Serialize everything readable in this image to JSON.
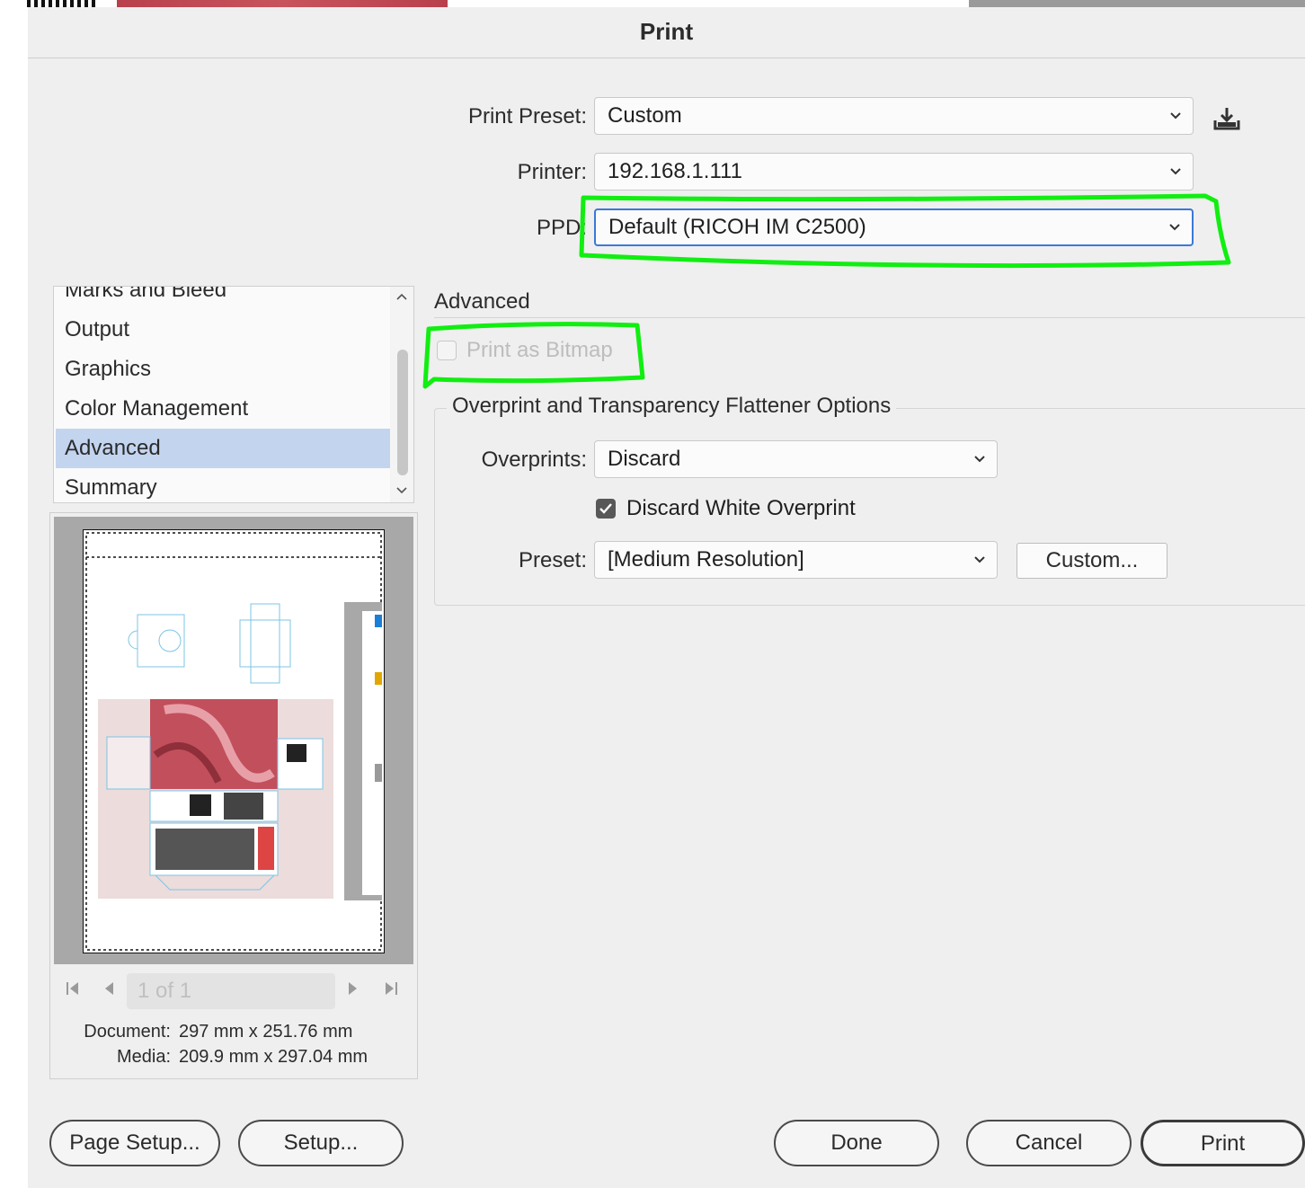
{
  "dialog": {
    "title": "Print"
  },
  "form": {
    "print_preset": {
      "label": "Print Preset:",
      "value": "Custom"
    },
    "printer": {
      "label": "Printer:",
      "value": "192.168.1.111"
    },
    "ppd": {
      "label": "PPD:",
      "value": "Default (RICOH IM C2500)"
    }
  },
  "sidebar": {
    "items": [
      {
        "label": "Marks and Bleed"
      },
      {
        "label": "Output"
      },
      {
        "label": "Graphics"
      },
      {
        "label": "Color Management"
      },
      {
        "label": "Advanced",
        "selected": true
      },
      {
        "label": "Summary"
      }
    ]
  },
  "preview": {
    "page_indicator": "1 of 1",
    "document_label": "Document:",
    "document_value": "297 mm x 251.76 mm",
    "media_label": "Media:",
    "media_value": "209.9 mm x 297.04 mm"
  },
  "advanced": {
    "section_title": "Advanced",
    "print_as_bitmap": {
      "label": "Print as Bitmap",
      "checked": false,
      "disabled": true
    },
    "group_title": "Overprint and Transparency Flattener Options",
    "overprints": {
      "label": "Overprints:",
      "value": "Discard"
    },
    "discard_white_overprint": {
      "label": "Discard White Overprint",
      "checked": true
    },
    "preset": {
      "label": "Preset:",
      "value": "[Medium Resolution]"
    },
    "custom_button": "Custom..."
  },
  "footer": {
    "page_setup": "Page Setup...",
    "setup": "Setup...",
    "done": "Done",
    "cancel": "Cancel",
    "print": "Print"
  },
  "colors": {
    "accent": "#3b78d8",
    "selection": "#c3d4ef",
    "highlight_annotation": "#11ee11",
    "checkbox_checked": "#585858"
  },
  "icons": {
    "save_preset": "download-tray-icon",
    "dropdown": "chevron-down-icon",
    "scroll_up": "chevron-up-icon",
    "scroll_down": "chevron-down-icon",
    "first_page": "first-page-icon",
    "prev_page": "previous-page-icon",
    "next_page": "next-page-icon",
    "last_page": "last-page-icon",
    "checkmark": "checkmark-icon"
  }
}
